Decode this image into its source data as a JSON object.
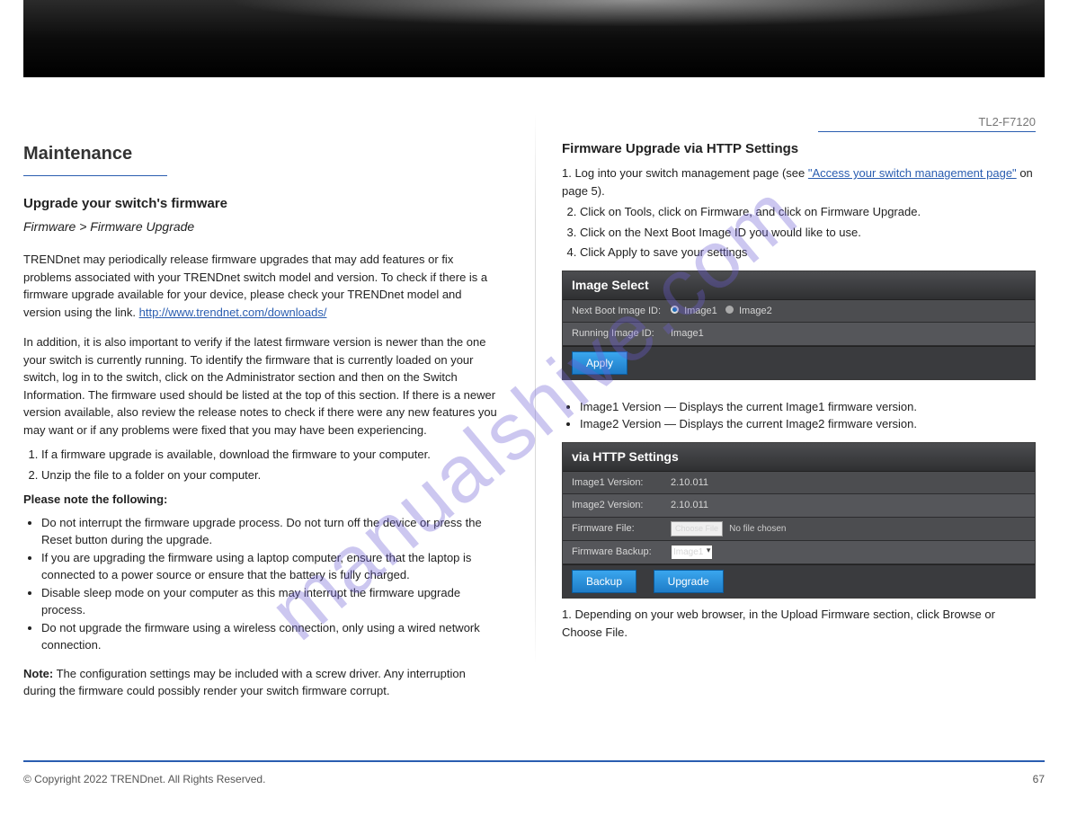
{
  "left": {
    "section_title": "Maintenance",
    "subhead": "Upgrade your switch's firmware",
    "subintro": "Firmware > Firmware Upgrade",
    "note_bold": "Note:",
    "note_text": " The configuration settings may be included with a screw driver. Any interruption during the firmware could possibly render your switch firmware corrupt.",
    "intro": "TRENDnet may periodically release firmware upgrades that may add features or fix problems associated with your TRENDnet switch model and version. To check if there is a firmware upgrade available for your device, please check your TRENDnet model and version using the link.",
    "link": "http://www.trendnet.com/downloads/",
    "para2": "In addition, it is also important to verify if the latest firmware version is newer than the one your switch is currently running. To identify the firmware that is currently loaded on your switch, log in to the switch, click on the Administrator section and then on the Switch Information. The firmware used should be listed at the top of this section. If there is a newer version available, also review the release notes to check if there were any new features you may want or if any problems were fixed that you may have been experiencing.",
    "steps": [
      "If a firmware upgrade is available, download the firmware to your computer.",
      "Unzip the file to a folder on your computer."
    ],
    "tips_label": "Please note the following:",
    "tips": [
      "Do not interrupt the firmware upgrade process. Do not turn off the device or press the Reset button during the upgrade.",
      "If you are upgrading the firmware using a laptop computer, ensure that the laptop is connected to a power source or ensure that the battery is fully charged.",
      "Disable sleep mode on your computer as this may interrupt the firmware upgrade process.",
      "Do not upgrade the firmware using a wireless connection, only using a wired network connection."
    ]
  },
  "right": {
    "heading": "Firmware Upgrade via HTTP Settings",
    "image_select_title": "Image Select",
    "next_boot_label": "Next Boot Image ID:",
    "next_boot_opt1": "Image1",
    "next_boot_opt2": "Image2",
    "running_label": "Running Image ID:",
    "running_value": "Image1",
    "apply": "Apply",
    "instr1": "1. Log into your switch management page (see ",
    "instr1_link": "\"Access your switch management page\"",
    "instr1b": " on page 5).",
    "steps2": [
      "Click on Tools, click on Firmware, and click on Firmware Upgrade.",
      "Click on the Next Boot Image ID you would like to use.",
      "Click Apply to save your settings"
    ],
    "bullets": [
      "Image1 Version — Displays the current Image1 firmware version.",
      "Image2 Version — Displays the current Image2 firmware version."
    ],
    "via_http_title": "via HTTP Settings",
    "img1v_label": "Image1 Version:",
    "img1v": "2.10.011",
    "img2v_label": "Image2 Version:",
    "img2v": "2.10.011",
    "fw_file_label": "Firmware File:",
    "choose_file": "Choose File",
    "no_file": "No file chosen",
    "fw_backup_label": "Firmware Backup:",
    "fw_backup_value": "Image1",
    "backup": "Backup",
    "upgrade": "Upgrade",
    "caption_num": "1.",
    "caption": " Depending on your web browser, in the Upload Firmware section, click Browse or Choose File.",
    "right_label": "TL2-F7120"
  },
  "footer": {
    "copyright": "© Copyright 2022 TRENDnet. All Rights Reserved.",
    "page": "67"
  },
  "watermark": "manualshive.com"
}
